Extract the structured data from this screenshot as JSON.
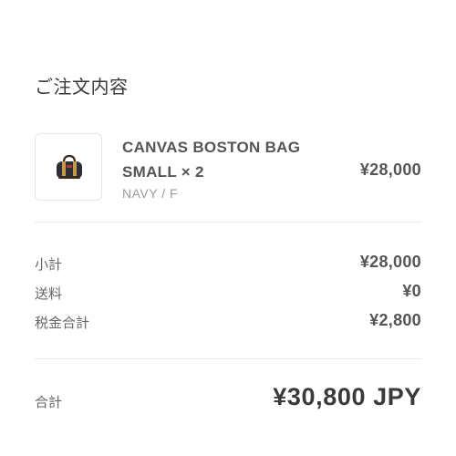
{
  "order_summary": {
    "title": "ご注文内容",
    "item": {
      "name": "CANVAS BOSTON BAG SMALL × 2",
      "variant": "NAVY / F",
      "price": "¥28,000",
      "thumbnail_icon": "boston-bag-icon"
    },
    "subtotal": {
      "label": "小計",
      "value": "¥28,000"
    },
    "shipping": {
      "label": "送料",
      "value": "¥0"
    },
    "tax": {
      "label": "税金合計",
      "value": "¥2,800"
    },
    "total": {
      "label": "合計",
      "value": "¥30,800 JPY"
    }
  }
}
